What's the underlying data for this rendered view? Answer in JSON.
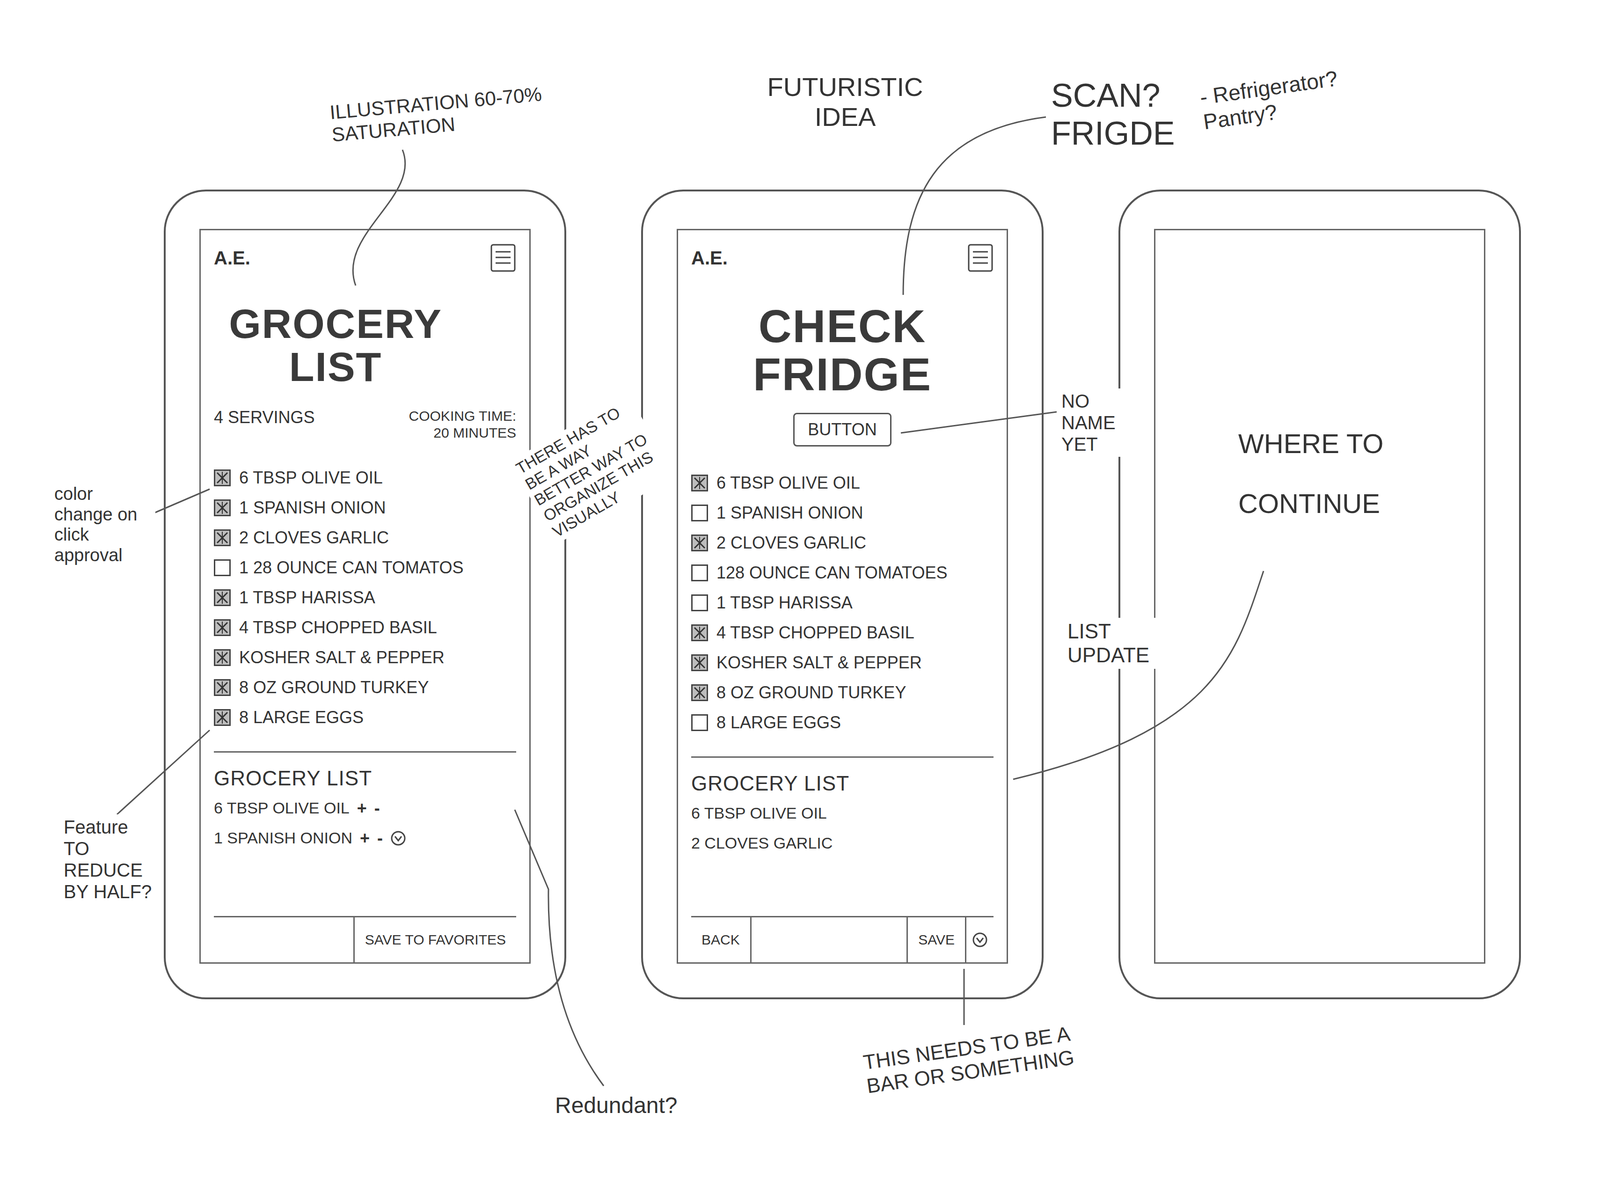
{
  "phones": [
    {
      "kind": "recipe",
      "logo": "A.E.",
      "title": "GROCERY LIST",
      "servings": "4 SERVINGS",
      "cooking_time": "COOKING TIME: 20 MINUTES",
      "ingredients": [
        {
          "text": "6 TBSP OLIVE OIL",
          "checked": true
        },
        {
          "text": "1 SPANISH ONION",
          "checked": true
        },
        {
          "text": "2 CLOVES GARLIC",
          "checked": true
        },
        {
          "text": "1 28 OUNCE CAN TOMATOS",
          "checked": false
        },
        {
          "text": "1 TBSP HARISSA",
          "checked": true
        },
        {
          "text": "4 TBSP CHOPPED BASIL",
          "checked": true
        },
        {
          "text": "KOSHER SALT & PEPPER",
          "checked": true
        },
        {
          "text": "8 OZ GROUND TURKEY",
          "checked": true
        },
        {
          "text": "8 LARGE EGGS",
          "checked": true
        }
      ],
      "list_title": "GROCERY LIST",
      "list_items": [
        {
          "text": "6 TBSP OLIVE OIL",
          "controls": [
            "+",
            "-"
          ]
        },
        {
          "text": "1 SPANISH ONION",
          "controls": [
            "+",
            "-"
          ]
        }
      ],
      "bottom_buttons": [
        "SAVE TO FAVORITES"
      ]
    },
    {
      "kind": "fridge",
      "logo": "A.E.",
      "title": "CHECK FRIDGE",
      "action_button": "BUTTON",
      "ingredients": [
        {
          "text": "6 TBSP OLIVE OIL",
          "checked": true
        },
        {
          "text": "1 SPANISH ONION",
          "checked": false
        },
        {
          "text": "2 CLOVES GARLIC",
          "checked": true
        },
        {
          "text": "128 OUNCE CAN TOMATOES",
          "checked": false
        },
        {
          "text": "1 TBSP HARISSA",
          "checked": false
        },
        {
          "text": "4 TBSP CHOPPED BASIL",
          "checked": true
        },
        {
          "text": "KOSHER SALT & PEPPER",
          "checked": true
        },
        {
          "text": "8 OZ GROUND TURKEY",
          "checked": true
        },
        {
          "text": "8 LARGE EGGS",
          "checked": false
        }
      ],
      "list_title": "GROCERY LIST",
      "list_items": [
        {
          "text": "6 TBSP OLIVE OIL",
          "controls": []
        },
        {
          "text": "2 CLOVES GARLIC",
          "controls": []
        }
      ],
      "bottom_buttons": [
        "BACK",
        "SAVE"
      ]
    },
    {
      "kind": "blank"
    }
  ],
  "notes": [
    "FUTURISTIC IDEA",
    "ILLUSTRATION 60-70% SATURATION",
    "SCAN? FRIGDE",
    "- Refrigerator? Pantry?",
    "color change on click approval",
    "THERE HAS TO BE A WAY BETTER WAY TO ORGANIZE THIS VISUALLY",
    "NO NAME YET",
    "LIST UPDATE",
    "WHERE TO CONTINUE",
    "Feature TO REDUCE BY HALF?",
    "Redundant?",
    "THIS NEEDS TO BE A BAR OR SOMETHING"
  ]
}
